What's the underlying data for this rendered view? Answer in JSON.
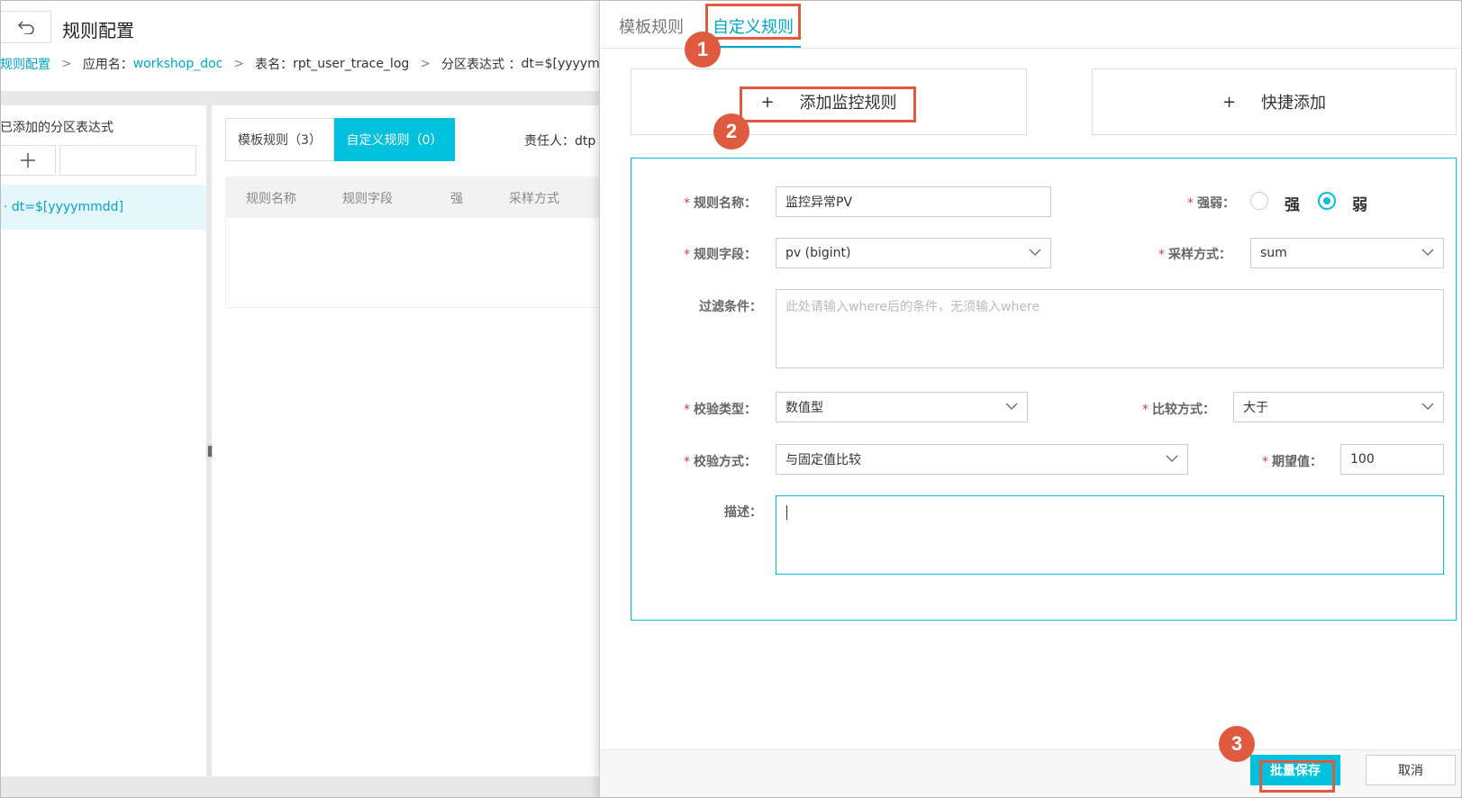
{
  "page": {
    "back_icon": "undo-arrow-icon",
    "title": "规则配置"
  },
  "breadcrumb": {
    "root": "规则配置",
    "app_label": "应用名：",
    "app_value": "workshop_doc",
    "table_label": "表名：",
    "table_value": "rpt_user_trace_log",
    "partition_label": "分区表达式 ：",
    "partition_value": "dt=$[yyyymmd"
  },
  "left_panel": {
    "title": "已添加的分区表达式",
    "add_icon": "plus-icon",
    "partition_item": "· dt=$[yyyymmdd]"
  },
  "main": {
    "tab_template": "模板规则（3）",
    "tab_custom": "自定义规则（0）",
    "owner": "责任人：dtp",
    "columns": [
      "规则名称",
      "规则字段",
      "强",
      "采样方式"
    ]
  },
  "drawer": {
    "tab_template": "模板规则",
    "tab_custom": "自定义规则",
    "add_rule": "添加监控规则",
    "quick_add": "快捷添加",
    "plus": "+",
    "form": {
      "rule_name_label": "规则名称：",
      "rule_name_value": "监控异常PV",
      "strength_label": "强弱：",
      "strength_strong": "强",
      "strength_weak": "弱",
      "rule_field_label": "规则字段：",
      "rule_field_value": "pv (bigint)",
      "sampling_label": "采样方式：",
      "sampling_value": "sum",
      "filter_label": "过滤条件：",
      "filter_placeholder": "此处请输入where后的条件，无须输入where",
      "check_type_label": "校验类型：",
      "check_type_value": "数值型",
      "compare_label": "比较方式：",
      "compare_value": "大于",
      "check_method_label": "校验方式：",
      "check_method_value": "与固定值比较",
      "expected_label": "期望值：",
      "expected_value": "100",
      "desc_label": "描述："
    },
    "save": "批量保存",
    "cancel": "取消"
  },
  "annotations": {
    "step1": "1",
    "step2": "2",
    "step3": "3",
    "color": "#e05a3f"
  },
  "colors": {
    "accent": "#00c1de",
    "link": "#00a6c9",
    "required": "#e03c3c"
  }
}
